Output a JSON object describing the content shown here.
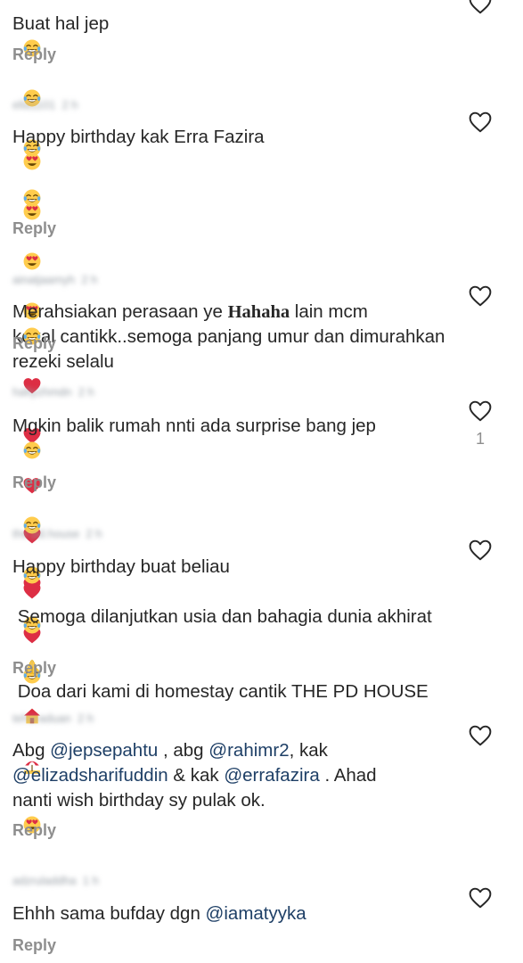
{
  "colors": {
    "text": "#262626",
    "muted": "#8e8e8e",
    "mention": "#1e3f66",
    "heart_red": "#dd2e44",
    "emoji_yellow": "#ffcc4d"
  },
  "comments": [
    {
      "username": "",
      "time": "",
      "text_parts": [
        {
          "t": "Buat hal jep"
        },
        {
          "emoji": "tears-of-joy"
        },
        {
          "emoji": "tears-of-joy"
        },
        {
          "emoji": "tears-of-joy"
        },
        {
          "emoji": "tears-of-joy"
        }
      ],
      "reply": "Reply",
      "likes": ""
    },
    {
      "username": "ella1101",
      "time": "2 h",
      "text_parts": [
        {
          "t": "Happy birthday kak Erra Fazira "
        },
        {
          "emoji": "heart-eyes"
        },
        {
          "emoji": "heart-eyes"
        },
        {
          "emoji": "heart-eyes"
        },
        {
          "emoji": "heart-eyes"
        },
        {
          "t": "kekal cantikk..semoga panjang umur dan dimurahkan rezeki selalu "
        },
        {
          "emoji": "red-heart"
        },
        {
          "emoji": "red-heart"
        },
        {
          "emoji": "red-heart"
        },
        {
          "emoji": "red-heart"
        },
        {
          "emoji": "red-heart"
        },
        {
          "emoji": "red-heart"
        }
      ],
      "reply": "Reply",
      "likes": ""
    },
    {
      "username": "ainatjaamyh",
      "time": "2 h",
      "text_parts": [
        {
          "t": "Merahsiakan perasaan ye "
        },
        {
          "strong": "Hahaha"
        },
        {
          "t": " lain mcm "
        },
        {
          "emoji": "tears-of-joy"
        }
      ],
      "reply": "Reply",
      "likes": ""
    },
    {
      "username": "hafiyzhmdn",
      "time": "2 h",
      "text_parts": [
        {
          "t": "Mgkin balik rumah nnti ada surprise bang jep "
        },
        {
          "emoji": "tears-of-joy"
        },
        {
          "t": "\n"
        },
        {
          "emoji": "tears-of-joy"
        },
        {
          "emoji": "tears-of-joy"
        },
        {
          "emoji": "tears-of-joy"
        },
        {
          "emoji": "tears-of-joy"
        }
      ],
      "reply": "Reply",
      "likes": "1"
    },
    {
      "username": "the.pd.house",
      "time": "2 h",
      "text_parts": [
        {
          "t": "Happy birthday buat beliau "
        },
        {
          "emoji": "red-heart"
        },
        {
          "t": " Semoga dilanjutkan usia dan bahagia dunia akhirat\n"
        },
        {
          "emoji": "folded-hands"
        },
        {
          "t": " Doa dari kami di homestay cantik THE PD HOUSE "
        },
        {
          "emoji": "house"
        },
        {
          "emoji": "beach-umbrella"
        }
      ],
      "reply": "Reply",
      "likes": ""
    },
    {
      "username": "teharaduan",
      "time": "2 h",
      "text_parts": [
        {
          "t": "Abg "
        },
        {
          "mention": "@jepsepahtu"
        },
        {
          "t": " , abg "
        },
        {
          "mention": "@rahimr2"
        },
        {
          "t": ", kak\n"
        },
        {
          "mention": "@elizadsharifuddin"
        },
        {
          "t": " & kak "
        },
        {
          "mention": "@errafazira"
        },
        {
          "t": " . Ahad\nnanti wish birthday sy pulak ok. "
        },
        {
          "emoji": "heart-eyes"
        }
      ],
      "reply": "Reply",
      "likes": ""
    },
    {
      "username": "adzruladdha",
      "time": "1 h",
      "text_parts": [
        {
          "t": "Ehhh sama bufday dgn "
        },
        {
          "mention": "@iamatyyka"
        }
      ],
      "reply": "Reply",
      "likes": ""
    }
  ]
}
